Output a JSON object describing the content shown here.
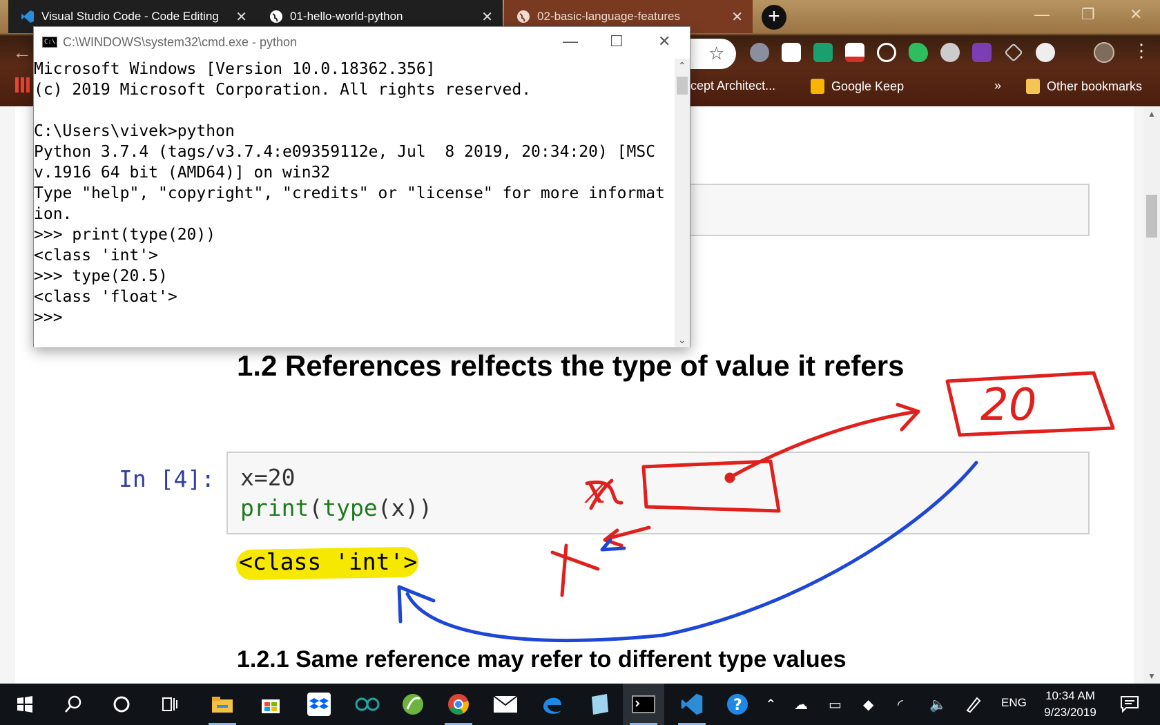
{
  "browser": {
    "tabs": [
      {
        "title": "Visual Studio Code - Code Editing",
        "icon": "vscode-icon"
      },
      {
        "title": "01-hello-world-python",
        "icon": "globe-icon"
      },
      {
        "title": "02-basic-language-features",
        "icon": "globe-icon"
      }
    ],
    "bookmarks": [
      "ncept Architect...",
      "Google Keep",
      "»",
      "Other bookmarks"
    ]
  },
  "cmd": {
    "title": "C:\\WINDOWS\\system32\\cmd.exe - python",
    "icon_text": "C:\\.",
    "lines": [
      "Microsoft Windows [Version 10.0.18362.356]",
      "(c) 2019 Microsoft Corporation. All rights reserved.",
      "",
      "C:\\Users\\vivek>python",
      "Python 3.7.4 (tags/v3.7.4:e09359112e, Jul  8 2019, 20:34:20) [MSC",
      "v.1916 64 bit (AMD64)] on win32",
      "Type \"help\", \"copyright\", \"credits\" or \"license\" for more informat",
      "ion.",
      ">>> print(type(20))",
      "<class 'int'>",
      ">>> type(20.5)",
      "<class 'float'>",
      ">>>"
    ]
  },
  "notebook": {
    "heading": "1.2 References relfects the type of value it refers",
    "cell_prompt": "In [4]:",
    "code_line1": "x=20",
    "code_line2_kw1": "print",
    "code_line2_p1": "(",
    "code_line2_kw2": "type",
    "code_line2_rest": "(x))",
    "output": "<class 'int'>",
    "subheading": "1.2.1 Same reference may refer to different type values"
  },
  "annotations": {
    "box_value": "20",
    "var_label": "x"
  },
  "taskbar": {
    "lang": "ENG",
    "time": "10:34 AM",
    "date": "9/23/2019"
  },
  "colors": {
    "annotation_red": "#e0201c",
    "annotation_blue": "#1f47d6",
    "highlight": "#f6e800",
    "prompt_blue": "#303f9f",
    "code_green": "#1e7a1e"
  }
}
